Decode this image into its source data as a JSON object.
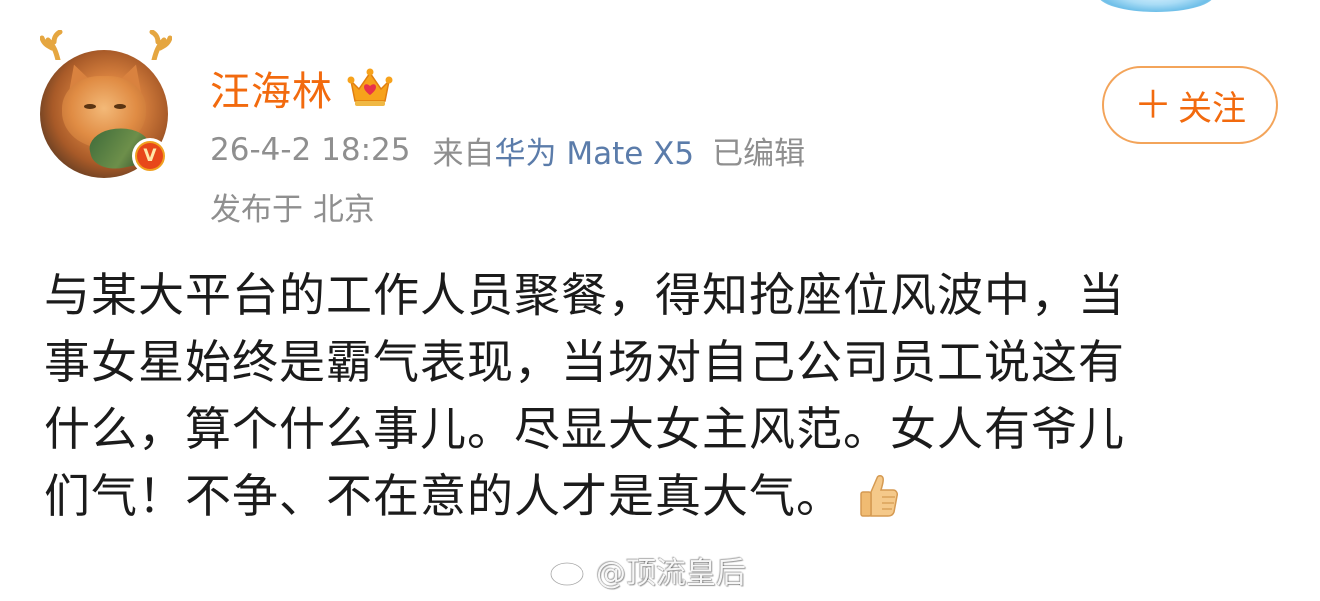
{
  "post": {
    "author": {
      "name": "汪海林",
      "verified_badge_letter": "V",
      "membership_icon": "crown-icon",
      "avatar_decoration": "antler-icon"
    },
    "meta": {
      "timestamp": "26-4-2 18:25",
      "source_prefix": "来自",
      "device": "华为 Mate X5",
      "edited": "已编辑",
      "location": "发布于 北京"
    },
    "follow_button": {
      "plus": "＋",
      "label": "关注"
    },
    "body_lines": [
      "与某大平台的工作人员聚餐，得知抢座位风波中，当",
      "事女星始终是霸气表现，当场对自己公司员工说这有",
      "什么，算个什么事儿。尽显大女主风范。女人有爷儿",
      "们气！不争、不在意的人才是真大气。"
    ],
    "emoji": "thumbs-up-icon"
  },
  "watermark": {
    "text": "@顶流皇后",
    "logo": "weibo-logo-icon"
  },
  "colors": {
    "username": "#f26a0e",
    "follow_border": "#f3a45a",
    "meta_gray": "#8f8f8f",
    "device_link": "#5b7caa",
    "body_text": "#1b1b1b",
    "badge_orange": "#f0a020",
    "badge_red": "#e8471a"
  }
}
